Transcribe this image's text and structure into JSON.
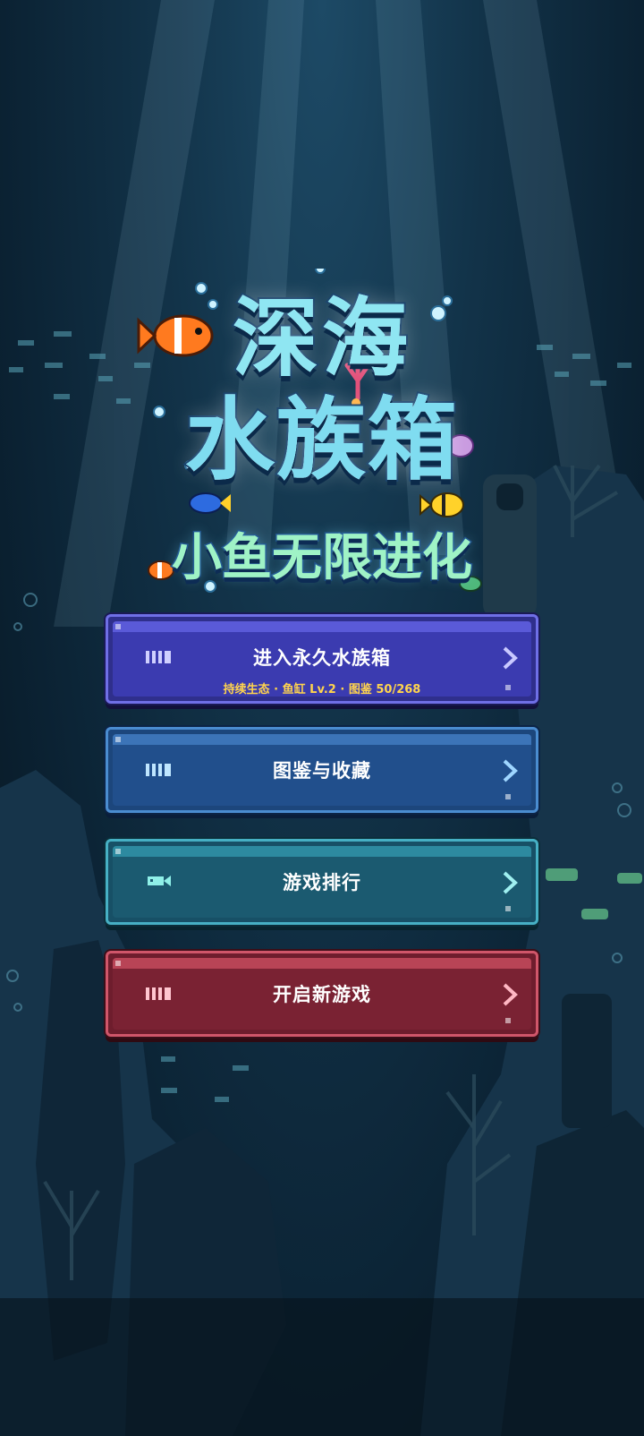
{
  "logo": {
    "title_line1": "深海",
    "title_line2": "水族箱",
    "subtitle": "小鱼无限进化"
  },
  "menu": [
    {
      "label": "进入永久水族箱",
      "detail": "持续生态 · 鱼缸 Lv.2 · 图鉴 50/268",
      "color": "#3e3eaa",
      "icon": "tank-icon"
    },
    {
      "label": "图鉴与收藏",
      "color": "#21508a",
      "icon": "book-icon"
    },
    {
      "label": "游戏排行",
      "color": "#1d5a6e",
      "icon": "fish-icon"
    },
    {
      "label": "开启新游戏",
      "color": "#7a2233",
      "icon": "tank-icon"
    }
  ]
}
